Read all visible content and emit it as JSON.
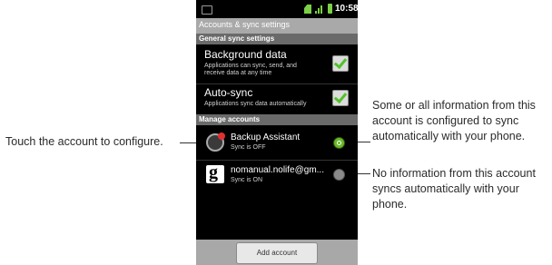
{
  "status_bar": {
    "time": "10:58"
  },
  "title": "Accounts & sync settings",
  "general_header": "General sync settings",
  "background_data": {
    "title": "Background data",
    "subtitle": "Applications can sync, send, and receive data at any time",
    "checked": true
  },
  "auto_sync": {
    "title": "Auto-sync",
    "subtitle": "Applications sync data automatically",
    "checked": true
  },
  "manage_header": "Manage accounts",
  "accounts": [
    {
      "name": "Backup Assistant",
      "status": "Sync is OFF",
      "icon": "backup-assistant-icon",
      "sync_icon": "sync-enabled-icon"
    },
    {
      "name": "nomanual.nolife@gm...",
      "status": "Sync is ON",
      "icon": "google-icon",
      "sync_icon": "sync-disabled-icon"
    }
  ],
  "add_account_label": "Add account",
  "callouts": {
    "left": "Touch the account to configure.",
    "right_top": "Some or all information from this account is configured to sync automatically with your phone.",
    "right_bottom": "No information from this account syncs automatically with your phone."
  },
  "colors": {
    "accent_green": "#52c22a",
    "title_bar": "#a9a9a9",
    "section_header": "#6a6a6a"
  }
}
